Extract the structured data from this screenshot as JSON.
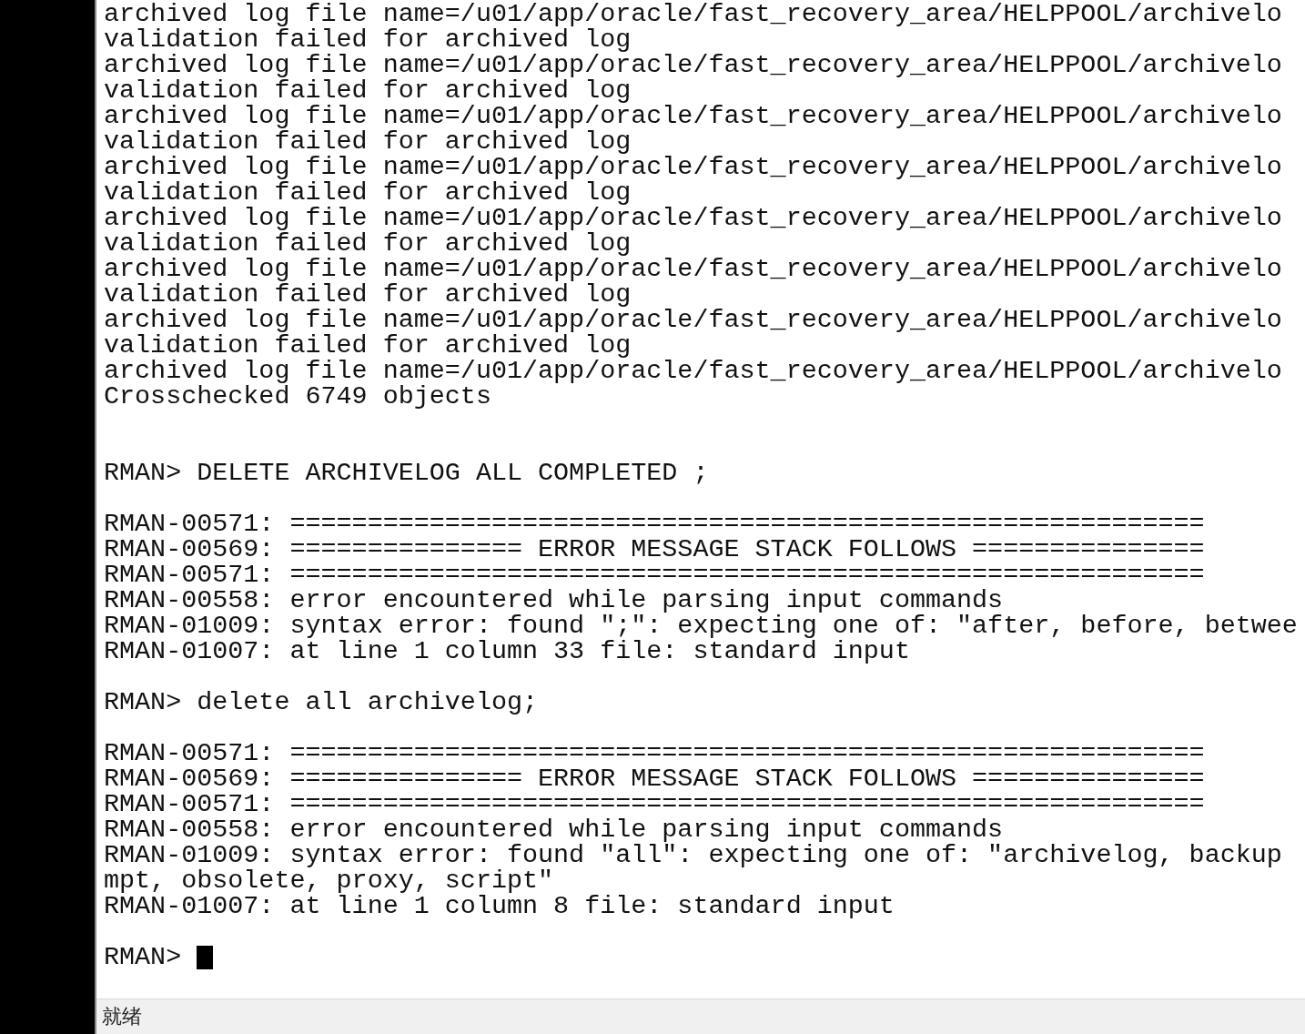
{
  "terminal": {
    "lines": [
      {
        "kind": "output",
        "text": "archived log file name=/u01/app/oracle/fast_recovery_area/HELPPOOL/archivelo"
      },
      {
        "kind": "output",
        "text": "validation failed for archived log"
      },
      {
        "kind": "output",
        "text": "archived log file name=/u01/app/oracle/fast_recovery_area/HELPPOOL/archivelo"
      },
      {
        "kind": "output",
        "text": "validation failed for archived log"
      },
      {
        "kind": "output",
        "text": "archived log file name=/u01/app/oracle/fast_recovery_area/HELPPOOL/archivelo"
      },
      {
        "kind": "output",
        "text": "validation failed for archived log"
      },
      {
        "kind": "output",
        "text": "archived log file name=/u01/app/oracle/fast_recovery_area/HELPPOOL/archivelo"
      },
      {
        "kind": "output",
        "text": "validation failed for archived log"
      },
      {
        "kind": "output",
        "text": "archived log file name=/u01/app/oracle/fast_recovery_area/HELPPOOL/archivelo"
      },
      {
        "kind": "output",
        "text": "validation failed for archived log"
      },
      {
        "kind": "output",
        "text": "archived log file name=/u01/app/oracle/fast_recovery_area/HELPPOOL/archivelo"
      },
      {
        "kind": "output",
        "text": "validation failed for archived log"
      },
      {
        "kind": "output",
        "text": "archived log file name=/u01/app/oracle/fast_recovery_area/HELPPOOL/archivelo"
      },
      {
        "kind": "output",
        "text": "validation failed for archived log"
      },
      {
        "kind": "output",
        "text": "archived log file name=/u01/app/oracle/fast_recovery_area/HELPPOOL/archivelo"
      },
      {
        "kind": "output",
        "text": "Crosschecked 6749 objects"
      },
      {
        "kind": "blank"
      },
      {
        "kind": "blank"
      },
      {
        "kind": "output",
        "text": "RMAN> DELETE ARCHIVELOG ALL COMPLETED ;"
      },
      {
        "kind": "blank"
      },
      {
        "kind": "output",
        "text": "RMAN-00571: ==========================================================="
      },
      {
        "kind": "output",
        "text": "RMAN-00569: =============== ERROR MESSAGE STACK FOLLOWS ==============="
      },
      {
        "kind": "output",
        "text": "RMAN-00571: ==========================================================="
      },
      {
        "kind": "output",
        "text": "RMAN-00558: error encountered while parsing input commands"
      },
      {
        "kind": "output",
        "text": "RMAN-01009: syntax error: found \";\": expecting one of: \"after, before, betwee"
      },
      {
        "kind": "output",
        "text": "RMAN-01007: at line 1 column 33 file: standard input"
      },
      {
        "kind": "blank"
      },
      {
        "kind": "output",
        "text": "RMAN> delete all archivelog;"
      },
      {
        "kind": "blank"
      },
      {
        "kind": "output",
        "text": "RMAN-00571: ==========================================================="
      },
      {
        "kind": "output",
        "text": "RMAN-00569: =============== ERROR MESSAGE STACK FOLLOWS ==============="
      },
      {
        "kind": "output",
        "text": "RMAN-00571: ==========================================================="
      },
      {
        "kind": "output",
        "text": "RMAN-00558: error encountered while parsing input commands"
      },
      {
        "kind": "output",
        "text": "RMAN-01009: syntax error: found \"all\": expecting one of: \"archivelog, backup"
      },
      {
        "kind": "output",
        "text": "mpt, obsolete, proxy, script\""
      },
      {
        "kind": "output",
        "text": "RMAN-01007: at line 1 column 8 file: standard input"
      },
      {
        "kind": "blank"
      },
      {
        "kind": "input",
        "text": "RMAN>"
      }
    ]
  },
  "status_bar": {
    "text": "就绪"
  }
}
